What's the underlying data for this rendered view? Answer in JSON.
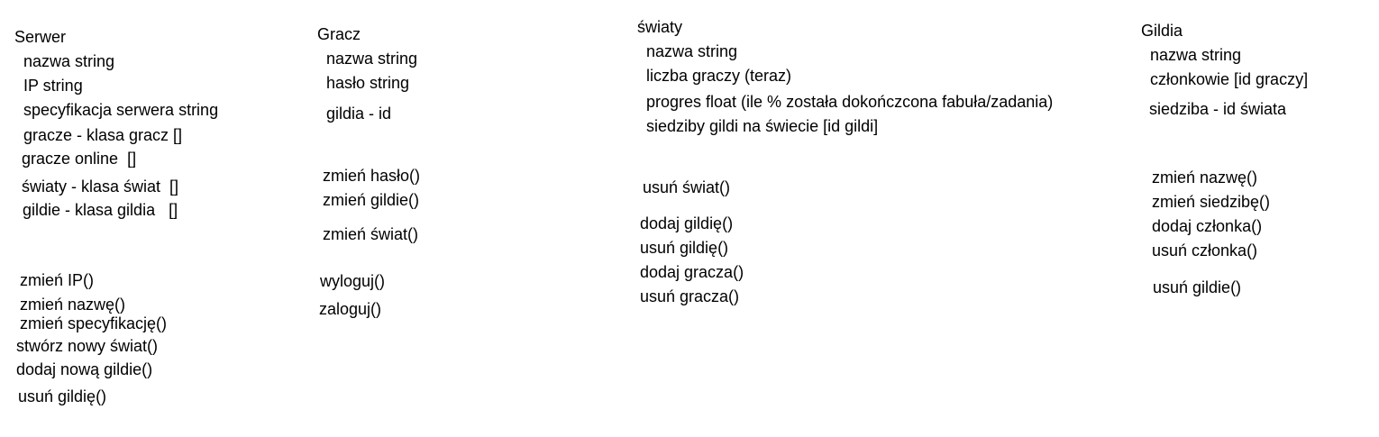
{
  "serwer": {
    "title": "Serwer",
    "fields": [
      "nazwa string",
      "IP string",
      "specyfikacja serwera string",
      "gracze - klasa gracz []",
      "gracze online  []",
      "światy - klasa świat  []",
      "gildie - klasa gildia   []"
    ],
    "methods": [
      "zmień IP()",
      "zmień nazwę()",
      "zmień specyfikację()",
      "stwórz nowy świat()",
      "dodaj nową gildie()",
      "usuń gildię()"
    ]
  },
  "gracz": {
    "title": "Gracz",
    "fields": [
      "nazwa string",
      "hasło string",
      "gildia - id"
    ],
    "methods": [
      "zmień hasło()",
      "zmień gildie()",
      "zmień świat()",
      "wyloguj()",
      "zaloguj()"
    ]
  },
  "swiaty": {
    "title": "światy",
    "fields": [
      "nazwa string",
      "liczba graczy (teraz)",
      "progres float (ile % została dokończcona fabuła/zadania)",
      "siedziby gildi na świecie [id gildi]"
    ],
    "methods": [
      "usuń świat()",
      "dodaj gildię()",
      "usuń gildię()",
      "dodaj gracza()",
      "usuń gracza()"
    ]
  },
  "gildia": {
    "title": "Gildia",
    "fields": [
      "nazwa string",
      "członkowie [id graczy]",
      "siedziba - id świata"
    ],
    "methods": [
      "zmień nazwę()",
      "zmień siedzibę()",
      "dodaj członka()",
      "usuń członka()",
      "usuń gildie()"
    ]
  }
}
